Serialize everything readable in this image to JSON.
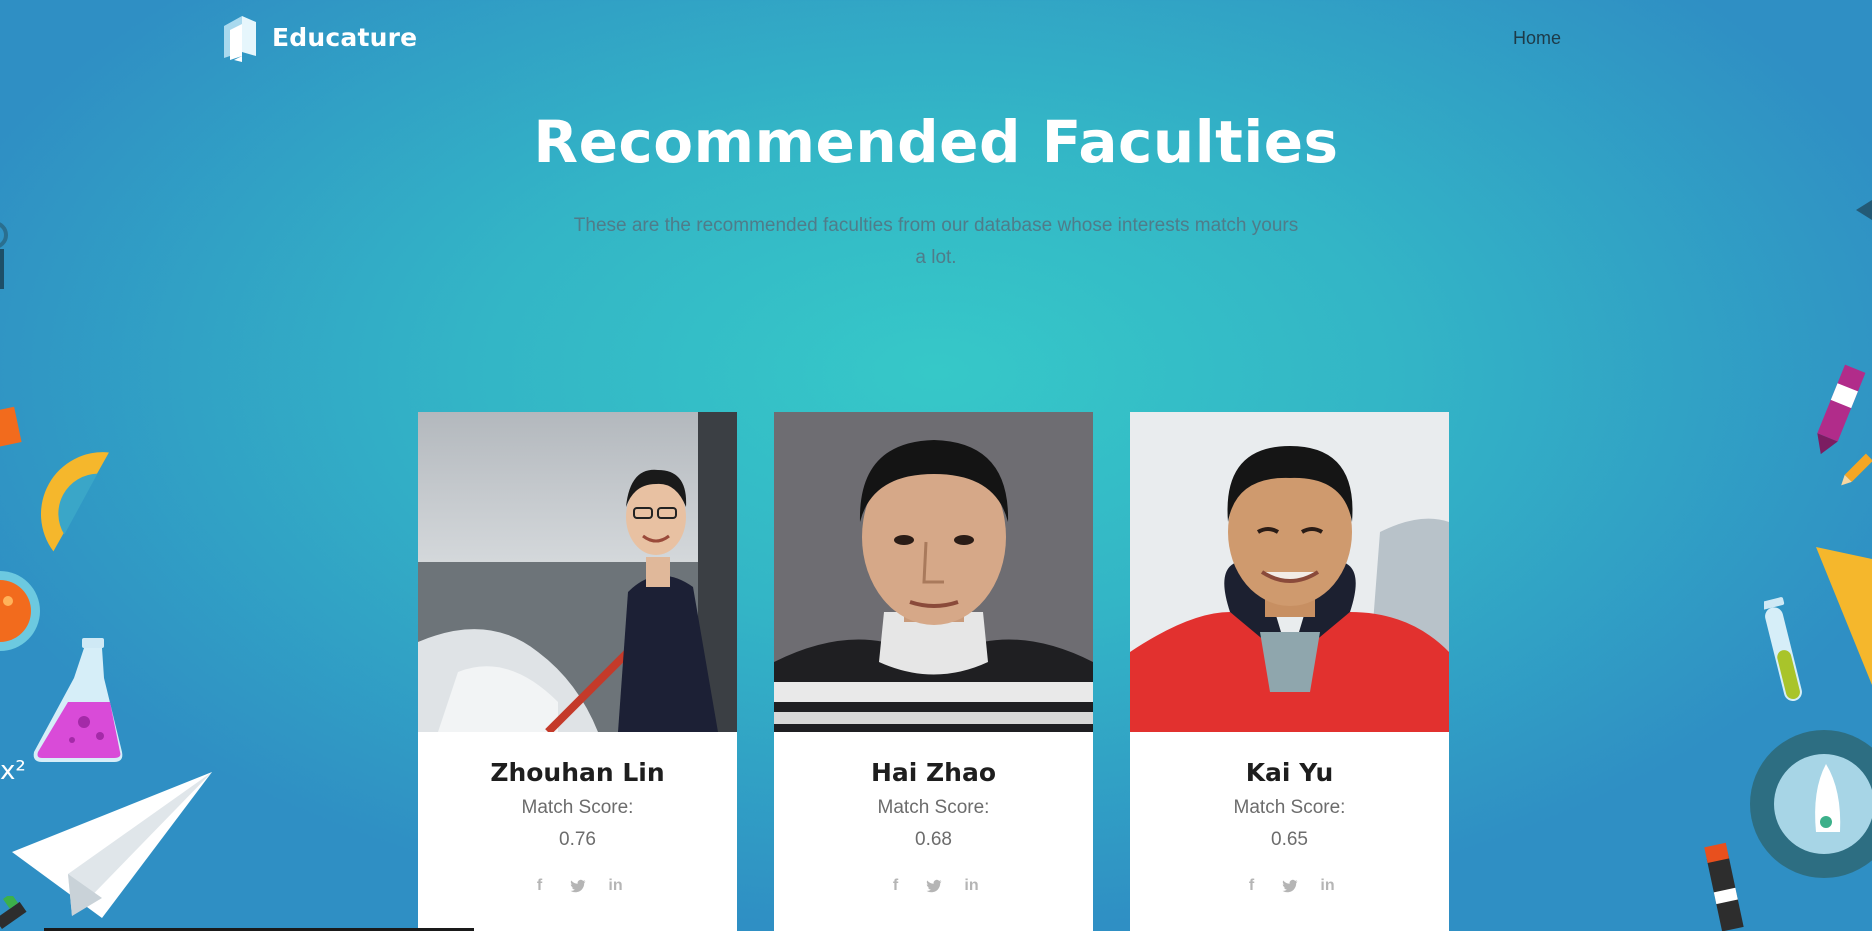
{
  "nav": {
    "brand": "Educature",
    "links": [
      "Home"
    ]
  },
  "hero": {
    "title": "Recommended Faculties",
    "subtitle": "These are the recommended faculties from our database whose interests match yours a lot."
  },
  "faculties": [
    {
      "name": "Zhouhan Lin",
      "score_label": "Match Score:",
      "score": "0.76"
    },
    {
      "name": "Hai Zhao",
      "score_label": "Match Score:",
      "score": "0.68"
    },
    {
      "name": "Kai Yu",
      "score_label": "Match Score:",
      "score": "0.65"
    }
  ],
  "social_icons": [
    "facebook-icon",
    "twitter-icon",
    "linkedin-icon"
  ],
  "decor_text": "x²",
  "colors": {
    "background_center": "#36c8c8",
    "background_edge": "#2f8fc4",
    "title": "#ffffff",
    "subtitle": "#4f7c8a",
    "card_bg": "#ffffff",
    "social_icon": "#b5b5b5"
  }
}
